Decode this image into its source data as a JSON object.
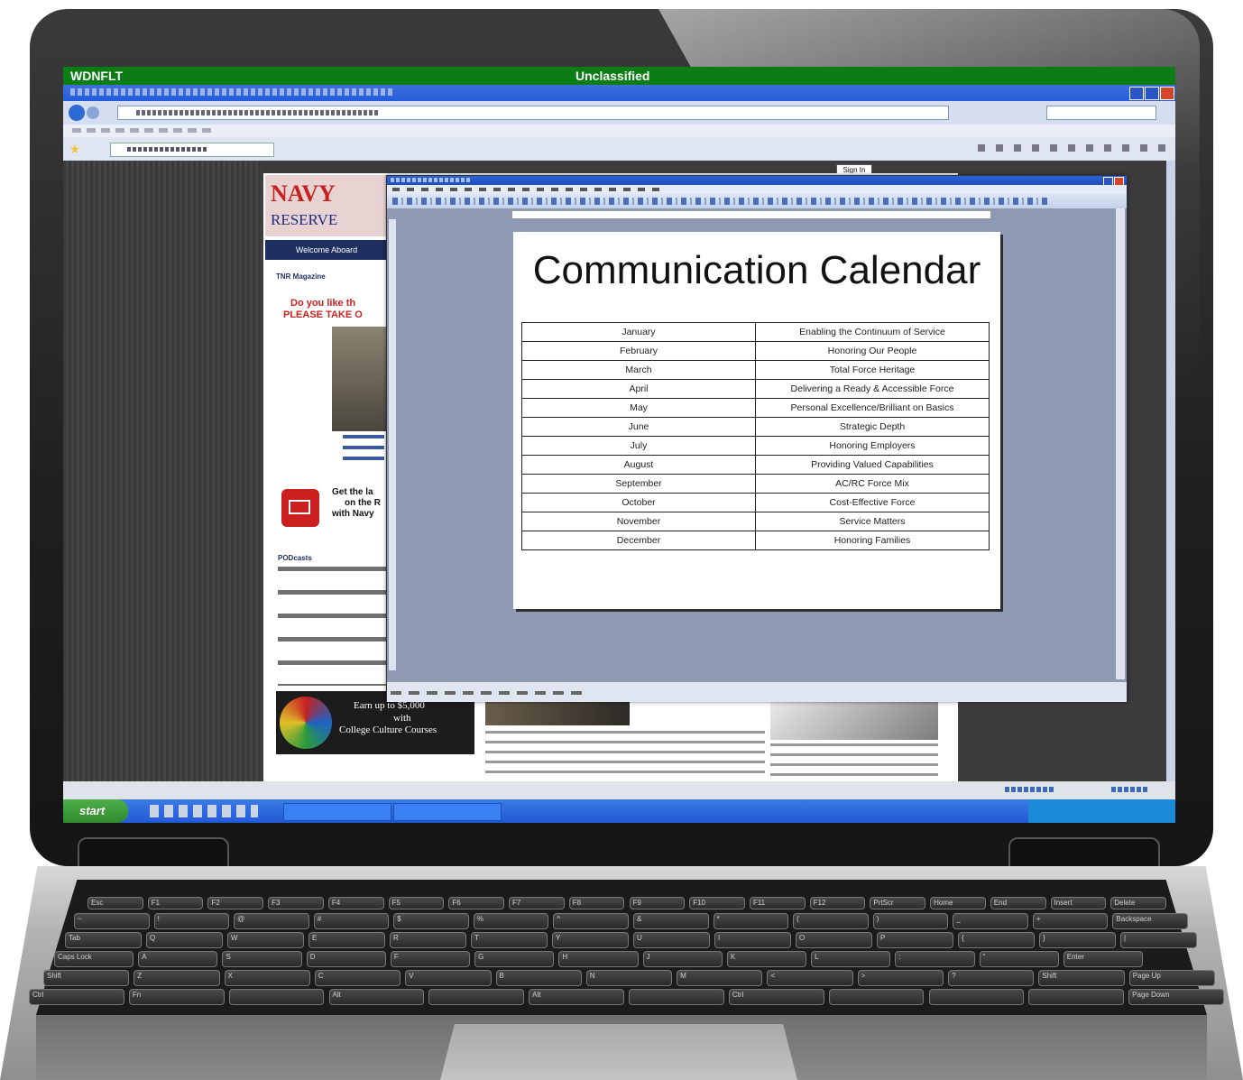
{
  "system": {
    "classification_left": "WDNFLT",
    "classification_center": "Unclassified"
  },
  "taskbar": {
    "start_label": "start"
  },
  "browser": {
    "sign_in_label": "Sign In"
  },
  "website": {
    "logo_line1": "NAVY",
    "logo_line2": "RESERVE",
    "nav_welcome": "Welcome Aboard",
    "section_magazine": "TNR Magazine",
    "promo_line1": "Do you like th",
    "promo_line2": "PLEASE TAKE O",
    "email_line1": "Get the la",
    "email_line2": "on the R",
    "email_line3": "with Navy",
    "section_podcasts": "PODcasts",
    "ad_line1": "Earn up to $5,000",
    "ad_line2": "with",
    "ad_line3": "College Culture Courses"
  },
  "document": {
    "title": "Communication Calendar",
    "calendar": [
      {
        "month": "January",
        "theme": "Enabling the Continuum of Service"
      },
      {
        "month": "February",
        "theme": "Honoring Our People"
      },
      {
        "month": "March",
        "theme": "Total Force Heritage"
      },
      {
        "month": "April",
        "theme": "Delivering a Ready & Accessible Force"
      },
      {
        "month": "May",
        "theme": "Personal Excellence/Brilliant on Basics"
      },
      {
        "month": "June",
        "theme": "Strategic Depth"
      },
      {
        "month": "July",
        "theme": "Honoring Employers"
      },
      {
        "month": "August",
        "theme": "Providing Valued Capabilities"
      },
      {
        "month": "September",
        "theme": "AC/RC Force Mix"
      },
      {
        "month": "October",
        "theme": "Cost-Effective Force"
      },
      {
        "month": "November",
        "theme": "Service Matters"
      },
      {
        "month": "December",
        "theme": "Honoring Families"
      }
    ]
  },
  "keyboard": {
    "row_fn": [
      "Esc",
      "F1",
      "F2",
      "F3",
      "F4",
      "F5",
      "F6",
      "F7",
      "F8",
      "F9",
      "F10",
      "F11",
      "F12",
      "PrtScr",
      "Home",
      "End",
      "Insert",
      "Delete"
    ],
    "row_num": [
      "~",
      "!",
      "@",
      "#",
      "$",
      "%",
      "^",
      "&",
      "*",
      "(",
      ")",
      "_",
      "+",
      "Backspace"
    ],
    "row_q": [
      "Tab",
      "Q",
      "W",
      "E",
      "R",
      "T",
      "Y",
      "U",
      "I",
      "O",
      "P",
      "{",
      "}",
      "|"
    ],
    "row_a": [
      "Caps Lock",
      "A",
      "S",
      "D",
      "F",
      "G",
      "H",
      "J",
      "K",
      "L",
      ":",
      "\"",
      "Enter"
    ],
    "row_z": [
      "Shift",
      "Z",
      "X",
      "C",
      "V",
      "B",
      "N",
      "M",
      "<",
      ">",
      "?",
      "Shift",
      "Page Up"
    ],
    "row_ctrl": [
      "Ctrl",
      "Fn",
      "",
      "Alt",
      "",
      "Alt",
      "",
      "Ctrl",
      "",
      "",
      "",
      "Page Down"
    ]
  },
  "colors": {
    "classification_bar": "#0c7d14",
    "taskbar": "#225ad5",
    "start_button": "#2f8a2b",
    "navy_red": "#cc1f1f"
  }
}
